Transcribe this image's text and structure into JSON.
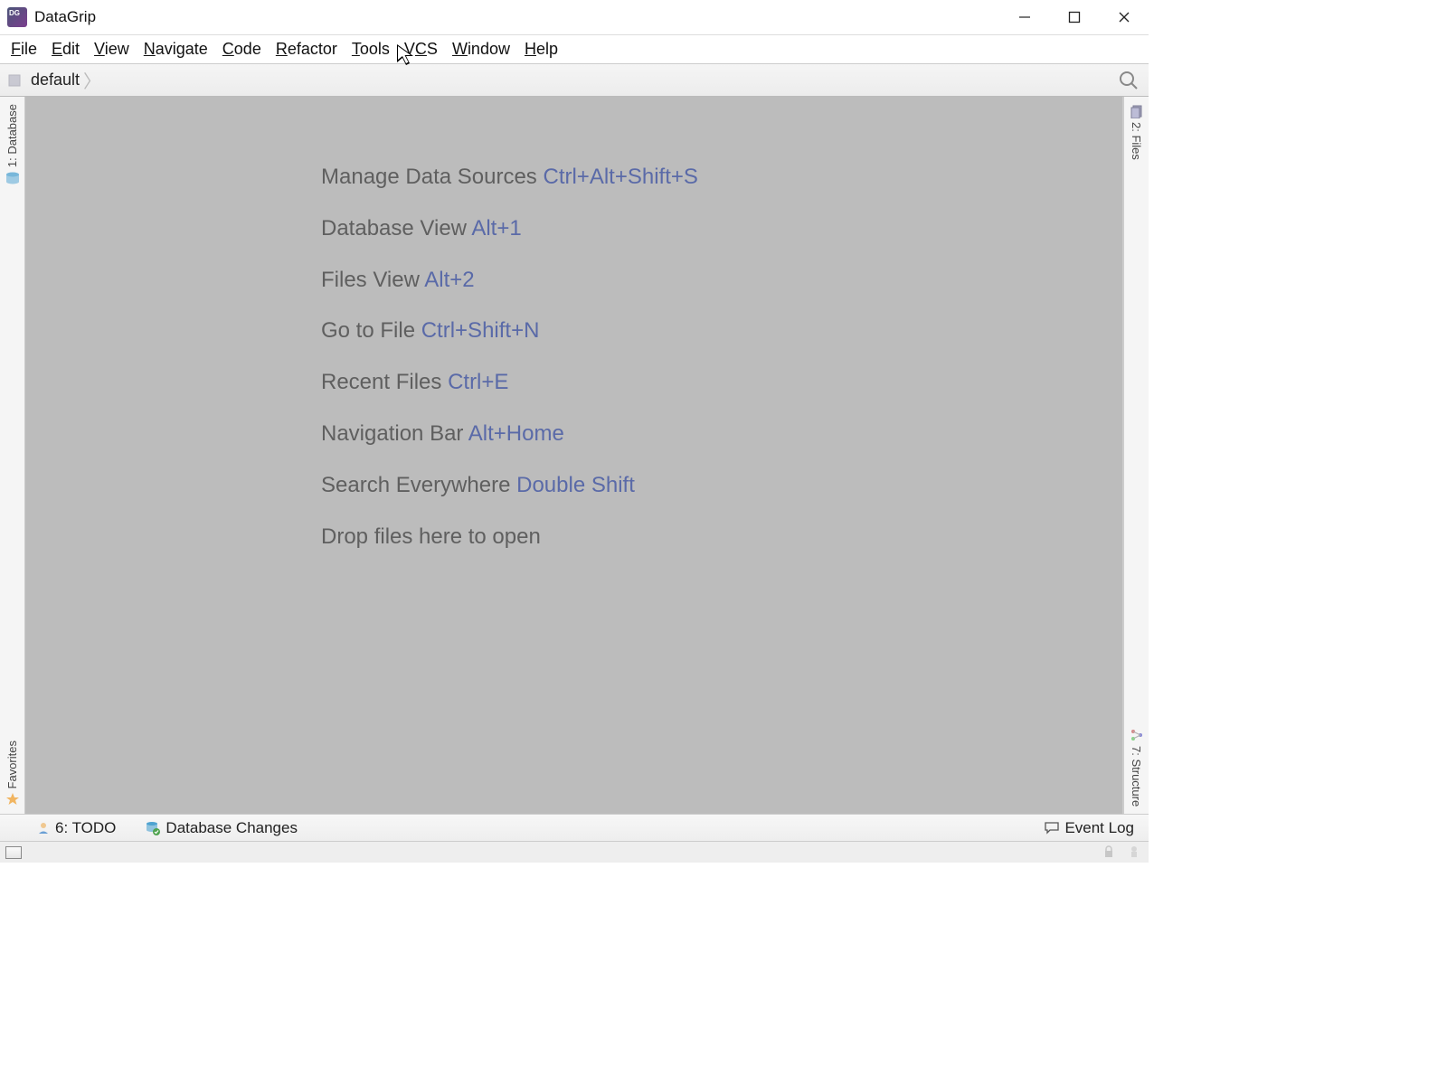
{
  "title": "DataGrip",
  "menus": [
    {
      "u": "F",
      "rest": "ile"
    },
    {
      "u": "E",
      "rest": "dit"
    },
    {
      "u": "V",
      "rest": "iew"
    },
    {
      "u": "N",
      "rest": "avigate"
    },
    {
      "u": "C",
      "rest": "ode"
    },
    {
      "u": "R",
      "rest": "efactor"
    },
    {
      "u": "T",
      "rest": "ools"
    },
    {
      "u": "",
      "rest": "V",
      "u2": "C",
      "rest2": "S"
    },
    {
      "u": "W",
      "rest": "indow"
    },
    {
      "u": "H",
      "rest": "elp"
    }
  ],
  "breadcrumb": "default",
  "left_tools": {
    "database": "1: Database",
    "favorites": "Favorites"
  },
  "right_tools": {
    "files": "2: Files",
    "structure": "7: Structure"
  },
  "tips": [
    {
      "label": "Manage Data Sources",
      "shortcut": "Ctrl+Alt+Shift+S"
    },
    {
      "label": "Database View",
      "shortcut": "Alt+1"
    },
    {
      "label": "Files View",
      "shortcut": "Alt+2"
    },
    {
      "label": "Go to File",
      "shortcut": "Ctrl+Shift+N"
    },
    {
      "label": "Recent Files",
      "shortcut": "Ctrl+E"
    },
    {
      "label": "Navigation Bar",
      "shortcut": "Alt+Home"
    },
    {
      "label": "Search Everywhere",
      "shortcut": "Double Shift"
    },
    {
      "label": "Drop files here to open",
      "shortcut": ""
    }
  ],
  "bottom": {
    "todo_u": "6",
    "todo_rest": ": TODO",
    "db_changes": "Database Changes",
    "event_log": "Event Log"
  }
}
